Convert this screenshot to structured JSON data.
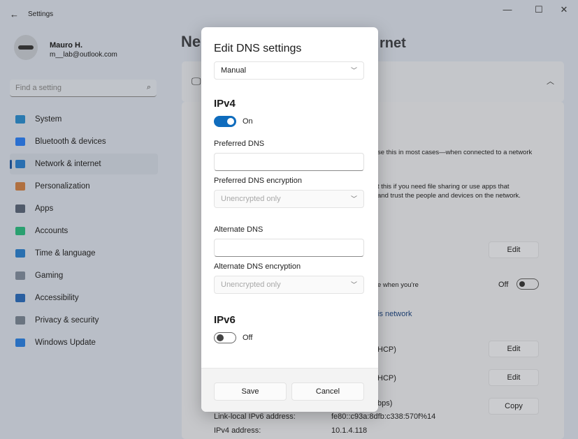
{
  "window": {
    "title": "Settings",
    "back": "←",
    "minimize": "—",
    "maximize": "☐",
    "close": "✕"
  },
  "user": {
    "name": "Mauro H.",
    "email": "m__lab@outlook.com"
  },
  "search": {
    "placeholder": "Find a setting"
  },
  "sidebar": {
    "items": [
      {
        "label": "System",
        "color": "#2a7ab0"
      },
      {
        "label": "Bluetooth & devices",
        "color": "#2a6fd0"
      },
      {
        "label": "Network & internet",
        "color": "#2a6fb0",
        "active": true
      },
      {
        "label": "Personalization",
        "color": "#b07040"
      },
      {
        "label": "Apps",
        "color": "#505a6a"
      },
      {
        "label": "Accounts",
        "color": "#2aa070"
      },
      {
        "label": "Time & language",
        "color": "#2a70b0"
      },
      {
        "label": "Gaming",
        "color": "#707a88"
      },
      {
        "label": "Accessibility",
        "color": "#2a5fa0"
      },
      {
        "label": "Privacy & security",
        "color": "#6a7480"
      },
      {
        "label": "Windows Update",
        "color": "#2a70c0"
      }
    ]
  },
  "page": {
    "title_start": "Ne",
    "title_end": "rnet"
  },
  "background": {
    "public_desc": "se this in most cases—when connected to a network",
    "private_desc1": "t this if you need file sharing or use apps that",
    "private_desc2": "and trust the people and devices on the network.",
    "edit1": "Edit",
    "metered_desc": "e when you're",
    "metered_state": "Off",
    "link": "is network",
    "ip_assign": "HCP)",
    "dns_assign": "HCP)",
    "speed": "bps)",
    "edit2": "Edit",
    "edit3": "Edit",
    "copy": "Copy",
    "ipv6_label": "Link-local IPv6 address:",
    "ipv6_value": "fe80::c93a:8dfb:c338:570f%14",
    "ipv4_label": "IPv4 address:",
    "ipv4_value": "10.1.4.118"
  },
  "dialog": {
    "title": "Edit DNS settings",
    "mode": "Manual",
    "ipv4": {
      "heading": "IPv4",
      "toggle": "On",
      "on": true,
      "preferred_label": "Preferred DNS",
      "preferred_value": "",
      "preferred_enc_label": "Preferred DNS encryption",
      "preferred_enc": "Unencrypted only",
      "alternate_label": "Alternate DNS",
      "alternate_value": "",
      "alternate_enc_label": "Alternate DNS encryption",
      "alternate_enc": "Unencrypted only"
    },
    "ipv6": {
      "heading": "IPv6",
      "toggle": "Off",
      "on": false
    },
    "save": "Save",
    "cancel": "Cancel"
  },
  "colors": {
    "accent": "#0f6cbd"
  }
}
